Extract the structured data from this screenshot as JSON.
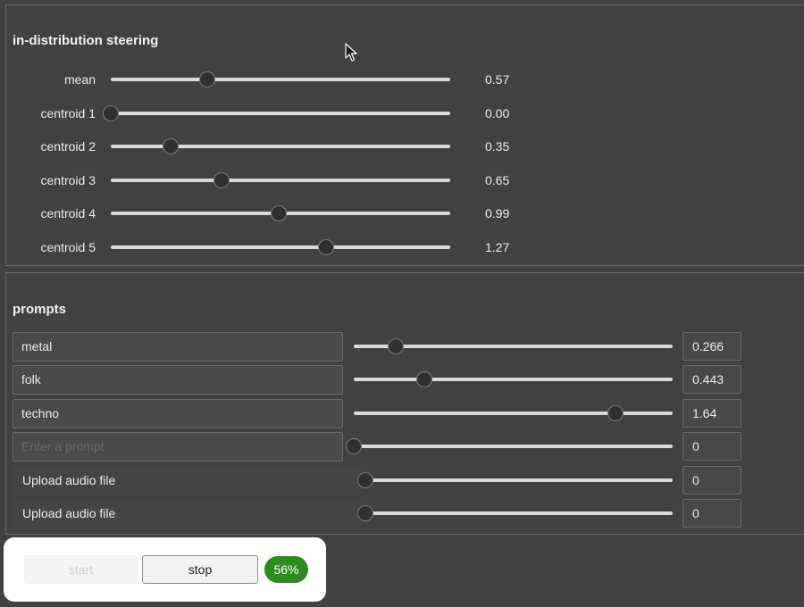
{
  "steering": {
    "title": "in-distribution steering",
    "rows": [
      {
        "label": "mean",
        "value": "0.57",
        "level": 0.285
      },
      {
        "label": "centroid 1",
        "value": "0.00",
        "level": 0.0
      },
      {
        "label": "centroid 2",
        "value": "0.35",
        "level": 0.175
      },
      {
        "label": "centroid 3",
        "value": "0.65",
        "level": 0.325
      },
      {
        "label": "centroid 4",
        "value": "0.99",
        "level": 0.495
      },
      {
        "label": "centroid 5",
        "value": "1.27",
        "level": 0.635
      }
    ]
  },
  "prompts": {
    "title": "prompts",
    "text_rows": [
      {
        "text": "metal",
        "value": "0.266",
        "level": 0.133
      },
      {
        "text": "folk",
        "value": "0.443",
        "level": 0.2215
      },
      {
        "text": "techno",
        "value": "1.64",
        "level": 0.82
      }
    ],
    "empty_row": {
      "placeholder": "Enter a prompt",
      "value": "0",
      "level": 0.0
    },
    "upload_rows": [
      {
        "label": "Upload audio file",
        "value": "0",
        "level": 0.0
      },
      {
        "label": "Upload audio file",
        "value": "0",
        "level": 0.0
      }
    ]
  },
  "controls": {
    "start_label": "start",
    "stop_label": "stop",
    "progress_text": "56%",
    "progress_color": "#2e8b1f"
  }
}
